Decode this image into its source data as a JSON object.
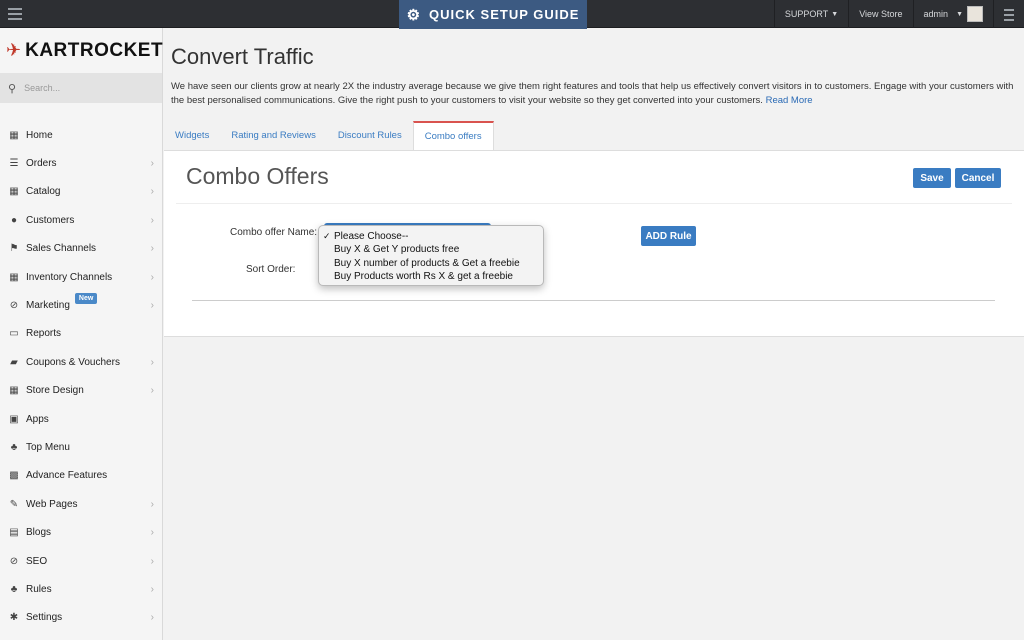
{
  "topbar": {
    "quick_setup": "QUICK SETUP GUIDE",
    "support": "SUPPORT",
    "view_store": "View Store",
    "admin": "admin"
  },
  "sidebar": {
    "brand": "KARTROCKET",
    "search_placeholder": "Search...",
    "items": [
      {
        "label": "Home",
        "icon": "home-icon",
        "glyph": "▦",
        "chevron": false
      },
      {
        "label": "Orders",
        "icon": "orders-icon",
        "glyph": "☰",
        "chevron": true
      },
      {
        "label": "Catalog",
        "icon": "catalog-icon",
        "glyph": "▦",
        "chevron": true
      },
      {
        "label": "Customers",
        "icon": "customers-icon",
        "glyph": "●",
        "chevron": true
      },
      {
        "label": "Sales Channels",
        "icon": "flag-icon",
        "glyph": "⚑",
        "chevron": true
      },
      {
        "label": "Inventory Channels",
        "icon": "grid-icon",
        "glyph": "▦",
        "chevron": true
      },
      {
        "label": "Marketing",
        "icon": "marketing-icon",
        "glyph": "⊘",
        "chevron": true,
        "badge": "New"
      },
      {
        "label": "Reports",
        "icon": "reports-icon",
        "glyph": "▭",
        "chevron": false
      },
      {
        "label": "Coupons & Vouchers",
        "icon": "coupon-icon",
        "glyph": "▰",
        "chevron": true
      },
      {
        "label": "Store Design",
        "icon": "design-icon",
        "glyph": "▦",
        "chevron": true
      },
      {
        "label": "Apps",
        "icon": "apps-icon",
        "glyph": "▣",
        "chevron": false
      },
      {
        "label": "Top Menu",
        "icon": "sitemap-icon",
        "glyph": "♣",
        "chevron": false
      },
      {
        "label": "Advance Features",
        "icon": "features-icon",
        "glyph": "▩",
        "chevron": false
      },
      {
        "label": "Web Pages",
        "icon": "pencil-icon",
        "glyph": "✎",
        "chevron": true
      },
      {
        "label": "Blogs",
        "icon": "calendar-icon",
        "glyph": "▤",
        "chevron": true
      },
      {
        "label": "SEO",
        "icon": "seo-icon",
        "glyph": "⊘",
        "chevron": true
      },
      {
        "label": "Rules",
        "icon": "rules-icon",
        "glyph": "♣",
        "chevron": true
      },
      {
        "label": "Settings",
        "icon": "settings-icon",
        "glyph": "✱",
        "chevron": true
      }
    ]
  },
  "main": {
    "title": "Convert Traffic",
    "intro": "We have seen our clients grow at nearly 2X the industry average because we give them right features and tools that help us effectively convert visitors in to customers. Engage with your customers with the best personalised communications. Give the right push to your customers to  visit your website so they get converted into your customers.",
    "read_more": "Read More",
    "tabs": [
      "Widgets",
      "Rating and Reviews",
      "Discount Rules",
      "Combo offers"
    ],
    "active_tab": "Combo offers"
  },
  "panel": {
    "title": "Combo Offers",
    "save": "Save",
    "cancel": "Cancel",
    "combo_name_label": "Combo offer Name:",
    "sort_order_label": "Sort Order:",
    "add_rule": "ADD Rule",
    "options": [
      "Please Choose--",
      "Buy X & Get Y products free",
      "Buy X number of products & Get a freebie",
      "Buy Products worth Rs X & get a freebie"
    ],
    "selected_option": "Please Choose--"
  },
  "colors": {
    "topbar": "#2d2f33",
    "accent": "#3a7cc2",
    "quick_setup_bg": "#3c5a82",
    "active_tab_border": "#d9534f"
  }
}
